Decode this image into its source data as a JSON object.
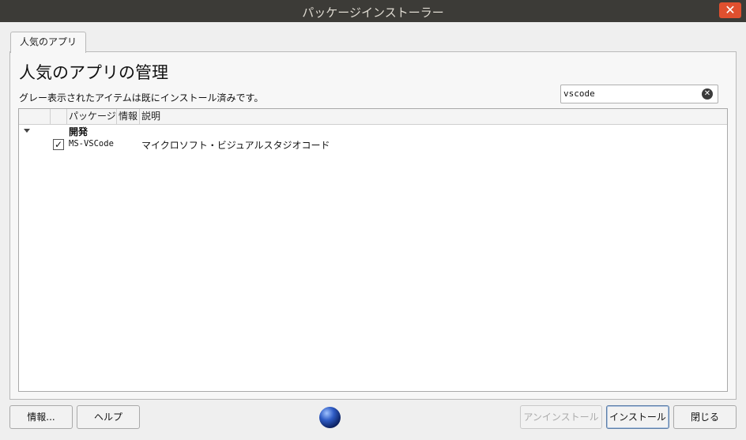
{
  "window": {
    "title": "パッケージインストーラー",
    "close_glyph": "✕"
  },
  "tab": {
    "label": "人気のアプリ"
  },
  "main": {
    "title": "人気のアプリの管理",
    "note": "グレー表示されたアイテムは既にインストール済みです。"
  },
  "search": {
    "value": "vscode",
    "clear_glyph": "✕"
  },
  "table": {
    "columns": [
      "パッケージ",
      "情報",
      "説明"
    ],
    "groups": [
      {
        "name": "開発",
        "expanded": true,
        "rows": [
          {
            "checked": true,
            "check_glyph": "✓",
            "package": "MS-VSCode",
            "info": "",
            "description": "マイクロソフト・ビジュアルスタジオコード"
          }
        ]
      }
    ]
  },
  "buttons": {
    "info": "情報...",
    "help": "ヘルプ",
    "uninstall": "アンインストール",
    "install": "インストール",
    "close": "閉じる"
  },
  "colors": {
    "titlebar": "#3c3b37",
    "close": "#e0502f",
    "accent": "#5d7ea7"
  },
  "icons": {
    "status": "globe-icon",
    "expander": "triangle-down-icon",
    "clear": "clear-search-icon"
  }
}
